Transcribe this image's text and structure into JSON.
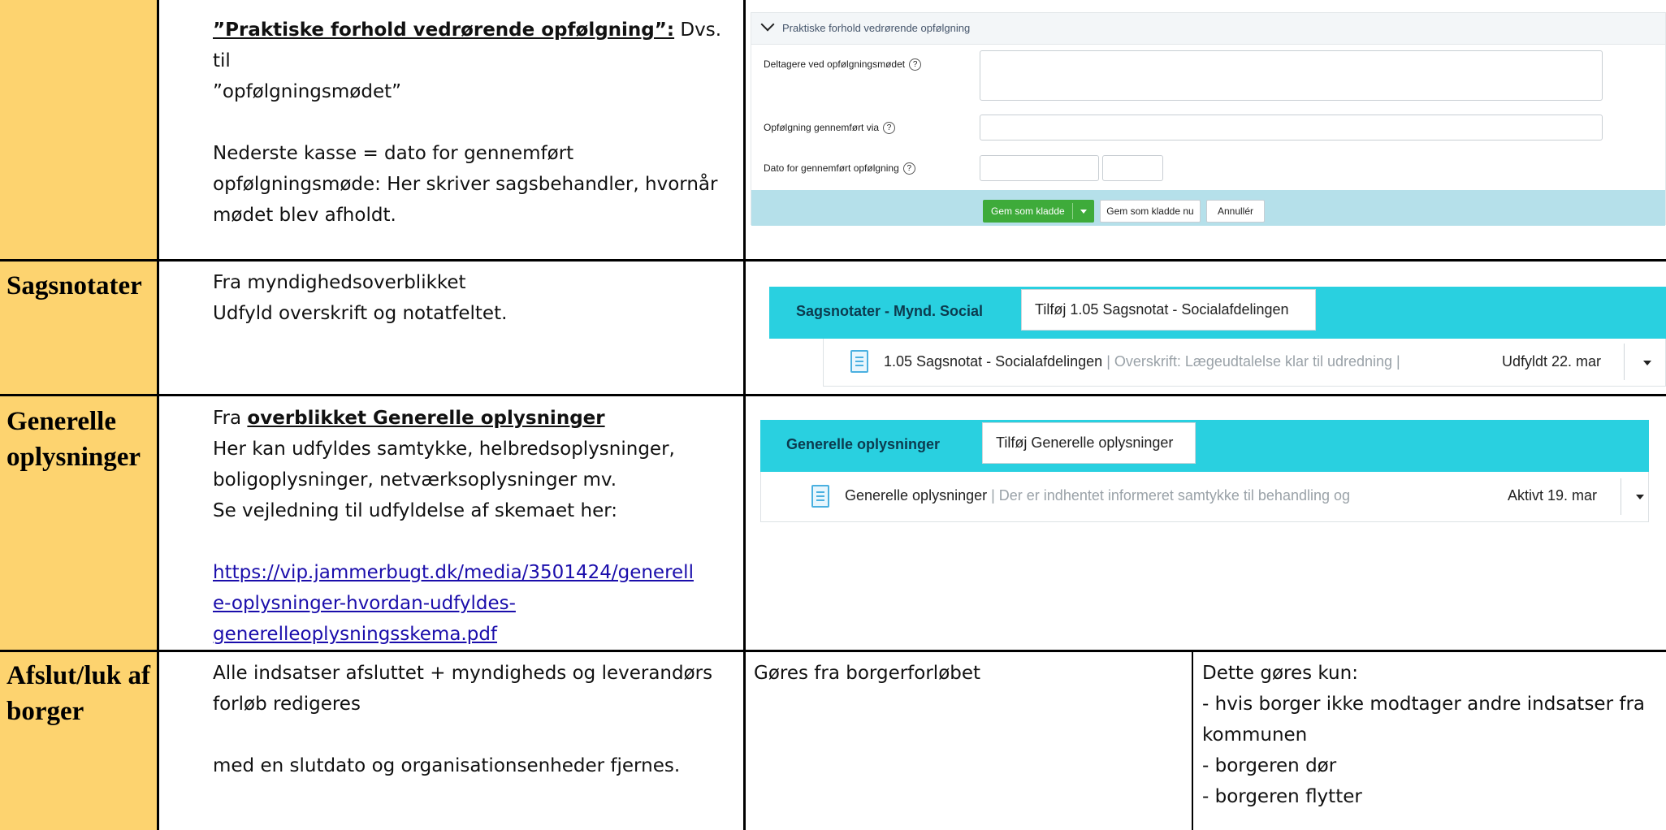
{
  "rows": [
    {
      "heading": "",
      "description": {
        "title": "”Praktiske forhold vedrørende opfølgning”:",
        "title_suffix": " Dvs. til",
        "line2": "”opfølgningsmødet”",
        "para2_l1": "Nederste kasse = dato for gennemført",
        "para2_l2": "opfølgningsmøde: Her skriver sagsbehandler, hvornår",
        "para2_l3": "mødet blev afholdt."
      }
    },
    {
      "heading": "Sagsnotater",
      "description": {
        "line1": "Fra myndighedsoverblikket",
        "line2": "Udfyld overskrift og notatfeltet."
      }
    },
    {
      "heading_l1": "Generelle",
      "heading_l2": "oplysninger",
      "description": {
        "prefix": "Fra ",
        "link_bold": "overblikket Generelle oplysninger",
        "line2": "Her kan udfyldes samtykke, helbredsoplysninger,",
        "line3": "boligoplysninger, netværksoplysninger mv.",
        "line4": "Se vejledning til udfyldelse af skemaet her:",
        "url_l1": "https://vip.jammerbugt.dk/media/3501424/generell",
        "url_l2": "e-oplysninger-hvordan-udfyldes-",
        "url_l3": "generelleoplysningsskema.pdf"
      }
    },
    {
      "heading_l1": "Afslut/luk af",
      "heading_l2": "borger",
      "description": {
        "line1": "Alle indsatser afsluttet + myndigheds og leverandørs",
        "line2": "forløb redigeres",
        "line3": "med en slutdato og organisationsenheder fjernes."
      },
      "col3": "Gøres fra borgerforløbet",
      "col4": {
        "l1": "Dette gøres kun:",
        "l2": "- hvis borger ikke modtager andre indsatser fra",
        "l3": "kommunen",
        "l4": "- borgeren dør",
        "l5": "- borgeren flytter"
      }
    }
  ],
  "followup_form": {
    "section_title": "Praktiske forhold vedrørende opfølgning",
    "field1_label": "Deltagere ved opfølgningsmødet",
    "field2_label": "Opfølgning gennemført via",
    "field3_label": "Dato for gennemført opfølgning",
    "help_glyph": "?",
    "save_draft_label": "Gem som kladde",
    "save_draft_now_label": "Gem som kladde nu",
    "cancel_label": "Annullér"
  },
  "case_notes_widget": {
    "title": "Sagsnotater - Mynd. Social",
    "add_label": "Tilføj 1.05 Sagsnotat - Socialafdelingen",
    "item_name": "1.05 Sagsnotat - Socialafdelingen",
    "item_detail": " | Overskrift: Lægeudtalelse klar til udredning |",
    "item_status": "Udfyldt 22. mar"
  },
  "general_info_widget": {
    "title": "Generelle oplysninger",
    "add_label": "Tilføj Generelle oplysninger",
    "item_name": "Generelle oplysninger",
    "item_detail": " | Der er indhentet informeret samtykke til behandling og",
    "item_status": "Aktivt 19. mar"
  },
  "colors": {
    "heading_column": "#fdd36f",
    "widget_header": "#29d0e0",
    "save_button": "#3eab3a",
    "button_bar": "#b5e0ea",
    "link": "#1a0dab"
  }
}
